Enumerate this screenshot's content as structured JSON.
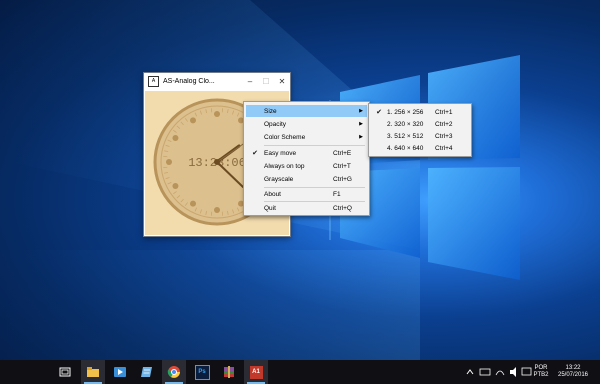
{
  "window": {
    "title": "AS-Analog Clo...",
    "app_icon_text": "A",
    "minimize_glyph": "–",
    "maximize_glyph": "☐",
    "close_glyph": "✕"
  },
  "clock": {
    "digital_time": "13:23:06",
    "face_color": "#dcc08e",
    "background_color": "#f2dcae"
  },
  "menu": {
    "items": [
      {
        "label": "Size",
        "shortcut": "",
        "checked": false,
        "submenu": true,
        "highlighted": true
      },
      {
        "label": "Opacity",
        "shortcut": "",
        "checked": false,
        "submenu": true,
        "highlighted": false
      },
      {
        "label": "Color Scheme",
        "shortcut": "",
        "checked": false,
        "submenu": true,
        "highlighted": false
      },
      {
        "label": "Easy move",
        "shortcut": "Ctrl+E",
        "checked": true,
        "submenu": false,
        "highlighted": false
      },
      {
        "label": "Always on top",
        "shortcut": "Ctrl+T",
        "checked": false,
        "submenu": false,
        "highlighted": false
      },
      {
        "label": "Grayscale",
        "shortcut": "Ctrl+G",
        "checked": false,
        "submenu": false,
        "highlighted": false
      },
      {
        "label": "About",
        "shortcut": "F1",
        "checked": false,
        "submenu": false,
        "highlighted": false
      },
      {
        "label": "Quit",
        "shortcut": "Ctrl+Q",
        "checked": false,
        "submenu": false,
        "highlighted": false
      }
    ],
    "check_glyph": "✔",
    "arrow_glyph": "▶"
  },
  "submenu": {
    "items": [
      {
        "label": "1. 256 × 256",
        "shortcut": "Ctrl+1",
        "checked": true
      },
      {
        "label": "2. 320 × 320",
        "shortcut": "Ctrl+2",
        "checked": false
      },
      {
        "label": "3. 512 × 512",
        "shortcut": "Ctrl+3",
        "checked": false
      },
      {
        "label": "4. 640 × 640",
        "shortcut": "Ctrl+4",
        "checked": false
      }
    ]
  },
  "taskbar": {
    "apps": [
      {
        "name": "task-view",
        "color": "#ffffff"
      },
      {
        "name": "file-explorer",
        "color": "#f0c04a"
      },
      {
        "name": "media-player",
        "color": "#3a8fd9"
      },
      {
        "name": "notepad",
        "color": "#6fb3e8"
      },
      {
        "name": "chrome",
        "color": "#dd4b39"
      },
      {
        "name": "photoshop",
        "color": "#2a5ba8"
      },
      {
        "name": "winrar",
        "color": "#8c4f9e"
      },
      {
        "name": "analog-clock",
        "color": "#c0392b"
      }
    ],
    "photoshop_label": "Ps",
    "clock_app_label": "A1",
    "language_line1": "POR",
    "language_line2": "PTB2",
    "time": "13:22",
    "date": "25/07/2016"
  }
}
